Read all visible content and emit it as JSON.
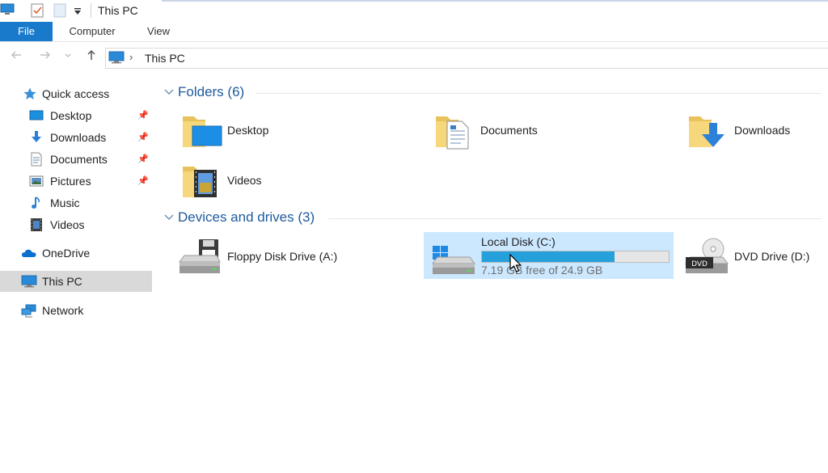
{
  "window": {
    "title": "This PC",
    "quick_access_toolbar": [
      "computer-icon",
      "properties-check-icon",
      "new-folder-icon",
      "customize-dropdown-icon"
    ]
  },
  "ribbon": {
    "tabs": [
      {
        "label": "File",
        "active": true
      },
      {
        "label": "Computer",
        "active": false
      },
      {
        "label": "View",
        "active": false
      }
    ],
    "file_tab_color": "#1979ca"
  },
  "address_bar": {
    "back": "arrow-left-icon",
    "forward": "arrow-right-icon",
    "recent": "chevron-down-icon",
    "up": "arrow-up-icon",
    "separator": "›",
    "location": "This PC"
  },
  "navigation": {
    "quick_access": {
      "label": "Quick access",
      "items": [
        {
          "label": "Desktop",
          "icon": "desktop-icon",
          "pinned": true
        },
        {
          "label": "Downloads",
          "icon": "downloads-icon",
          "pinned": true
        },
        {
          "label": "Documents",
          "icon": "documents-icon",
          "pinned": true
        },
        {
          "label": "Pictures",
          "icon": "pictures-icon",
          "pinned": true
        },
        {
          "label": "Music",
          "icon": "music-icon",
          "pinned": false
        },
        {
          "label": "Videos",
          "icon": "videos-icon",
          "pinned": false
        }
      ]
    },
    "onedrive": {
      "label": "OneDrive"
    },
    "this_pc": {
      "label": "This PC",
      "selected": true
    },
    "network": {
      "label": "Network"
    }
  },
  "content": {
    "folders_header": "Folders (6)",
    "folders": [
      {
        "label": "Desktop",
        "icon": "desktop-folder-icon"
      },
      {
        "label": "Documents",
        "icon": "documents-folder-icon"
      },
      {
        "label": "Downloads",
        "icon": "downloads-folder-icon"
      },
      {
        "label": "Videos",
        "icon": "videos-folder-icon"
      }
    ],
    "devices_header": "Devices and drives (3)",
    "drives": [
      {
        "label": "Floppy Disk Drive (A:)",
        "icon": "floppy-drive-icon"
      },
      {
        "label": "Local Disk (C:)",
        "icon": "windows-drive-icon",
        "selected": true,
        "free_text": "7.19 GB free of 24.9 GB",
        "used_fraction": 0.71
      },
      {
        "label": "DVD Drive (D:)",
        "icon": "dvd-drive-icon",
        "badge": "DVD"
      }
    ]
  },
  "colors": {
    "accent": "#1979ca",
    "selection": "#cce8ff",
    "group_header": "#1e5a9e",
    "usage_bar": "#26a0da"
  }
}
